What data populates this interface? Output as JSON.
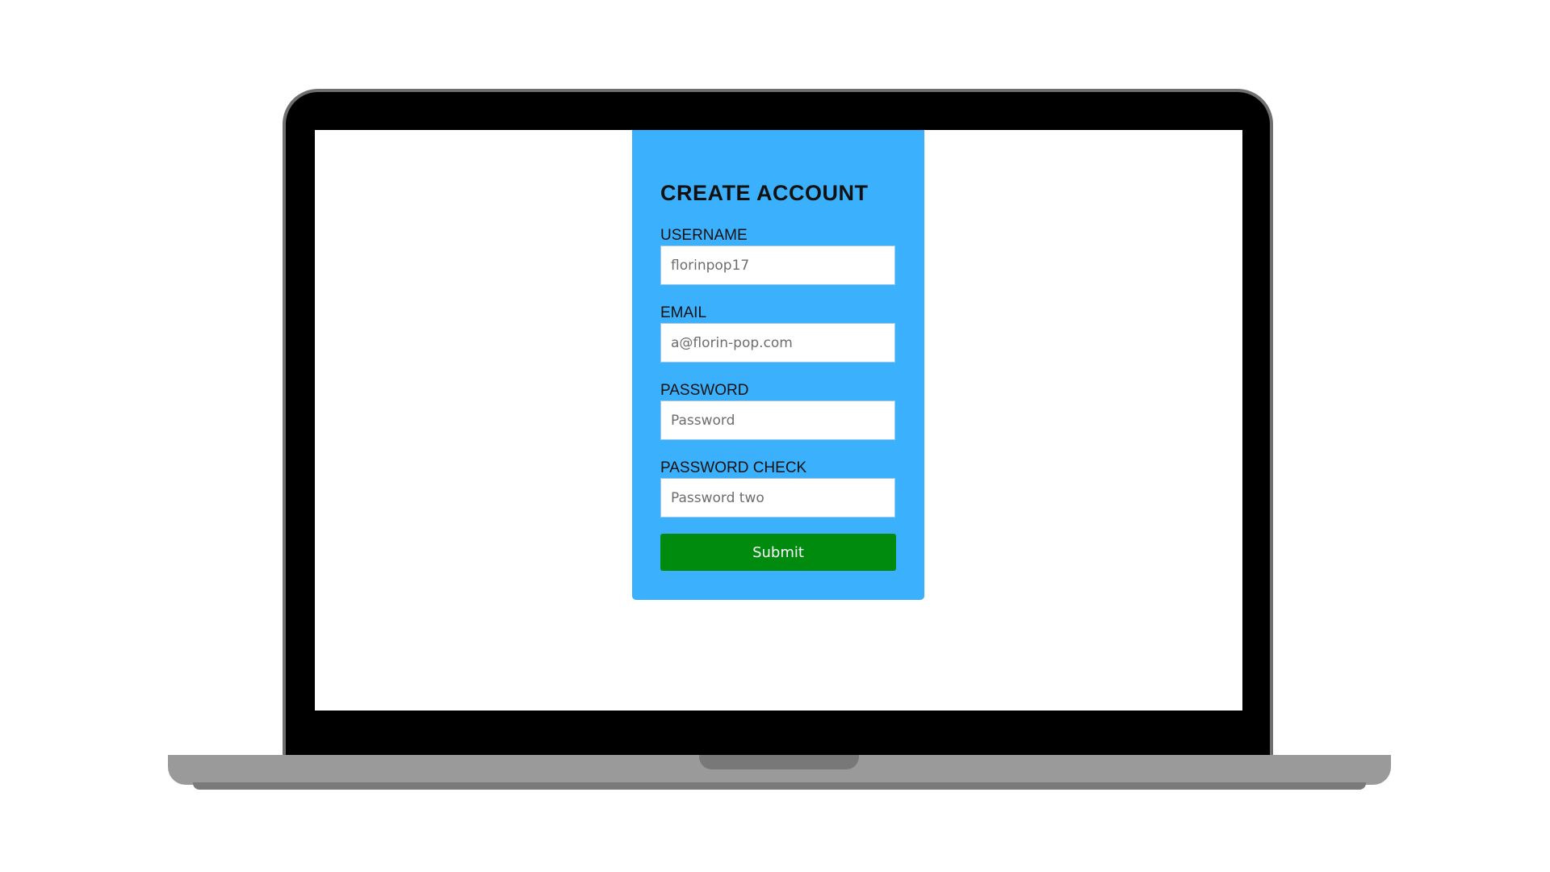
{
  "form": {
    "title": "CREATE ACCOUNT",
    "fields": [
      {
        "label": "USERNAME",
        "placeholder": "florinpop17",
        "type": "text"
      },
      {
        "label": "EMAIL",
        "placeholder": "a@florin-pop.com",
        "type": "email"
      },
      {
        "label": "PASSWORD",
        "placeholder": "Password",
        "type": "password"
      },
      {
        "label": "PASSWORD CHECK",
        "placeholder": "Password two",
        "type": "password"
      }
    ],
    "submit_label": "Submit"
  },
  "colors": {
    "card_background": "#3bb0fc",
    "submit_background": "#008a0e",
    "laptop_bezel": "#000000",
    "laptop_base": "#9a9a9a"
  }
}
